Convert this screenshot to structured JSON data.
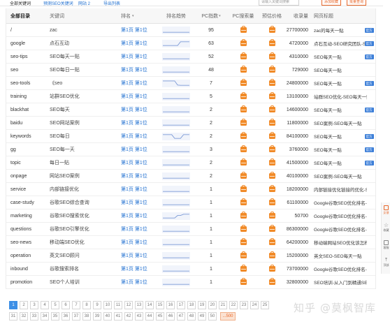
{
  "top_strip": {
    "items": [
      "全部关键词",
      "预测SEO关键词",
      "网站 2",
      "导出列表"
    ],
    "search_placeholder": "请输入关键词搜索",
    "buttons": [
      "添加收藏",
      "批量查询"
    ]
  },
  "table": {
    "headers": {
      "category": "全部目录",
      "keyword": "关键词",
      "rank": "排名",
      "trend": "排名趋势",
      "pc_index": "PC指数",
      "pc_search": "PC搜索量",
      "price": "预估价格",
      "revenue": "收录量",
      "title": "网页标题"
    },
    "rank_sort_icon": "sort-arrow-icon",
    "rows": [
      {
        "category": "/",
        "keyword": "zac",
        "rank": "第1页 第1位",
        "trend": [
          0.2,
          0.2,
          0.2,
          0.2,
          0.2,
          0.2,
          0.2,
          0.2,
          0.2,
          0.2
        ],
        "pc_index": "95",
        "revenue": "27700000",
        "title": "zac的每天一贴",
        "badge": "官方"
      },
      {
        "category": "google",
        "keyword": "点石互动",
        "rank": "第1页 第1位",
        "trend": [
          0.2,
          0.2,
          0.2,
          0.2,
          0.2,
          0.2,
          0.8,
          0.8,
          0.8,
          0.8
        ],
        "pc_index": "63",
        "revenue": "4720000",
        "title": "点石互动-SEO研究团队-SEO每...",
        "badge": "官方"
      },
      {
        "category": "seo-tips",
        "keyword": "SEO每天一贴",
        "rank": "第1页 第1位",
        "trend": [
          0.2,
          0.2,
          0.2,
          0.2,
          0.2,
          0.2,
          0.2,
          0.2,
          0.2,
          0.2
        ],
        "pc_index": "52",
        "revenue": "4310000",
        "title": "SEO每天一贴",
        "badge": "官方"
      },
      {
        "category": "seo",
        "keyword": "SEO每日一贴",
        "rank": "第1页 第1位",
        "trend": [
          0.2,
          0.2,
          0.2,
          0.2,
          0.2,
          0.2,
          0.2,
          0.2,
          0.2,
          0.2
        ],
        "pc_index": "48",
        "revenue": "729000",
        "title": "SEO每天一贴",
        "badge": ""
      },
      {
        "category": "seo-tools",
        "keyword": "《seo",
        "rank": "第1页 第1位",
        "trend": [
          0.9,
          0.9,
          0.9,
          0.9,
          0.9,
          0.25,
          0.2,
          0.2,
          0.2,
          0.2
        ],
        "pc_index": "7",
        "revenue": "24800000",
        "title": "SEO每天一贴",
        "badge": "官方"
      },
      {
        "category": "training",
        "keyword": "站群SEO优化",
        "rank": "第1页 第1位",
        "trend": [
          0.2,
          0.2,
          0.2,
          0.2,
          0.2,
          0.2,
          0.2,
          0.2,
          0.2,
          0.2
        ],
        "pc_index": "5",
        "revenue": "13100000",
        "title": "站群SEO优化-SEO每天一贴",
        "badge": ""
      },
      {
        "category": "blackhat",
        "keyword": "SEO每天",
        "rank": "第1页 第1位",
        "trend": [
          0.2,
          0.2,
          0.2,
          0.2,
          0.2,
          0.2,
          0.2,
          0.2,
          0.2,
          0.2
        ],
        "pc_index": "2",
        "revenue": "14600000",
        "title": "SEO每天一贴",
        "badge": "官方"
      },
      {
        "category": "baidu",
        "keyword": "SEO网站案例",
        "rank": "第1页 第1位",
        "trend": [
          0.2,
          0.2,
          0.2,
          0.2,
          0.2,
          0.2,
          0.2,
          0.2,
          0.2,
          0.2
        ],
        "pc_index": "2",
        "revenue": "11800000",
        "title": "SEO案例-SEO每天一贴",
        "badge": ""
      },
      {
        "category": "keywords",
        "keyword": "SEO每日",
        "rank": "第1页 第1位",
        "trend": [
          0.8,
          0.8,
          0.8,
          0.8,
          0.2,
          0.2,
          0.2,
          0.8,
          0.8,
          0.8
        ],
        "pc_index": "2",
        "revenue": "84100000",
        "title": "SEO每天一贴",
        "badge": "官方"
      },
      {
        "category": "gg",
        "keyword": "SEO每一天",
        "rank": "第1页 第1位",
        "trend": [
          0.2,
          0.2,
          0.2,
          0.2,
          0.2,
          0.2,
          0.2,
          0.2,
          0.2,
          0.2
        ],
        "pc_index": "3",
        "revenue": "3760000",
        "title": "SEO每天一贴",
        "badge": "官方"
      },
      {
        "category": "topic",
        "keyword": "每日一贴",
        "rank": "第1页 第1位",
        "trend": [
          0.2,
          0.2,
          0.2,
          0.2,
          0.2,
          0.2,
          0.2,
          0.2,
          0.2,
          0.2
        ],
        "pc_index": "2",
        "revenue": "41500000",
        "title": "SEO每天一贴",
        "badge": "官方"
      },
      {
        "category": "onpage",
        "keyword": "网站SEO案例",
        "rank": "第1页 第1位",
        "trend": [
          0.2,
          0.2,
          0.2,
          0.2,
          0.2,
          0.2,
          0.2,
          0.2,
          0.2,
          0.2
        ],
        "pc_index": "2",
        "revenue": "40100000",
        "title": "SEO案例-SEO每天一贴",
        "badge": ""
      },
      {
        "category": "service",
        "keyword": "内部链接优化",
        "rank": "第1页 第1位",
        "trend": [
          0.2,
          0.2,
          0.2,
          0.2,
          0.2,
          0.2,
          0.2,
          0.2,
          0.2,
          0.2
        ],
        "pc_index": "1",
        "revenue": "18200000",
        "title": "内部链接优化链接的优化-SEO...",
        "badge": ""
      },
      {
        "category": "case-study",
        "keyword": "谷歌SEO综合查询",
        "rank": "第1页 第1位",
        "trend": [
          0.2,
          0.2,
          0.2,
          0.2,
          0.2,
          0.2,
          0.2,
          0.2,
          0.2,
          0.2
        ],
        "pc_index": "1",
        "revenue": "61100000",
        "title": "Google谷歌SEO优化排名-SEO...",
        "badge": ""
      },
      {
        "category": "marketing",
        "keyword": "谷歌SEO搜索优化",
        "rank": "第1页 第1位",
        "trend": [
          0.2,
          0.2,
          0.2,
          0.2,
          0.2,
          0.6,
          0.6,
          0.8,
          0.8,
          0.8
        ],
        "pc_index": "1",
        "revenue": "50700",
        "title": "Google谷歌SEO优化排名-SEO...",
        "badge": ""
      },
      {
        "category": "questions",
        "keyword": "谷歌SEO引擎优化",
        "rank": "第1页 第1位",
        "trend": [
          0.2,
          0.2,
          0.2,
          0.2,
          0.2,
          0.2,
          0.2,
          0.2,
          0.2,
          0.2
        ],
        "pc_index": "1",
        "revenue": "86300000",
        "title": "Google谷歌SEO优化排名-SEO...",
        "badge": ""
      },
      {
        "category": "seo-news",
        "keyword": "移动端SEO优化",
        "rank": "第1页 第1位",
        "trend": [
          0.2,
          0.2,
          0.2,
          0.2,
          0.2,
          0.2,
          0.2,
          0.2,
          0.2,
          0.2
        ],
        "pc_index": "1",
        "revenue": "64200000",
        "title": "移动端网站SEO优化该怎样做?...",
        "badge": ""
      },
      {
        "category": "operation",
        "keyword": "英文SEO顾问",
        "rank": "第1页 第1位",
        "trend": [
          0.2,
          0.2,
          0.2,
          0.2,
          0.2,
          0.2,
          0.2,
          0.2,
          0.2,
          0.2
        ],
        "pc_index": "1",
        "revenue": "15200000",
        "title": "英文SEO-SEO每天一贴",
        "badge": ""
      },
      {
        "category": "inbound",
        "keyword": "谷歌搜索排名",
        "rank": "第1页 第1位",
        "trend": [
          0.2,
          0.2,
          0.2,
          0.2,
          0.2,
          0.2,
          0.2,
          0.2,
          0.2,
          0.2
        ],
        "pc_index": "1",
        "revenue": "73700000",
        "title": "Google谷歌SEO优化排名-SEO...",
        "badge": ""
      },
      {
        "category": "promotion",
        "keyword": "SEO个人培训",
        "rank": "第1页 第1位",
        "trend": [
          0.2,
          0.2,
          0.2,
          0.2,
          0.2,
          0.2,
          0.2,
          0.2,
          0.2,
          0.2
        ],
        "pc_index": "1",
        "revenue": "32800000",
        "title": "SEO培训-从入门到精通SEO实...",
        "badge": ""
      }
    ]
  },
  "pagination": {
    "row1": [
      "1",
      "2",
      "3",
      "4",
      "5",
      "6",
      "7",
      "8",
      "9",
      "10",
      "11",
      "12",
      "13",
      "14",
      "15",
      "16",
      "17",
      "18",
      "19",
      "20",
      "21",
      "22",
      "23",
      "24",
      "25"
    ],
    "row2": [
      "31",
      "32",
      "33",
      "34",
      "35",
      "36",
      "37",
      "38",
      "39",
      "40",
      "41",
      "42",
      "43",
      "44",
      "45",
      "46",
      "47",
      "48",
      "49",
      "50"
    ],
    "next_label": "...500",
    "active": "1"
  },
  "sidebar": {
    "items": [
      {
        "label": "反馈",
        "icon": "feedback-icon"
      },
      {
        "label": "收藏",
        "icon": "star-icon"
      },
      {
        "label": "客服",
        "icon": "chat-icon"
      },
      {
        "label": "顶部",
        "icon": "back-to-top-icon"
      }
    ]
  },
  "watermark": {
    "brand": "知乎",
    "author": "@莫枫智库"
  },
  "colors": {
    "link_blue": "#1f6fd0",
    "accent_orange": "#f18a27",
    "active_page": "#3d8fe6",
    "badge_blue": "#3d7fd8"
  }
}
